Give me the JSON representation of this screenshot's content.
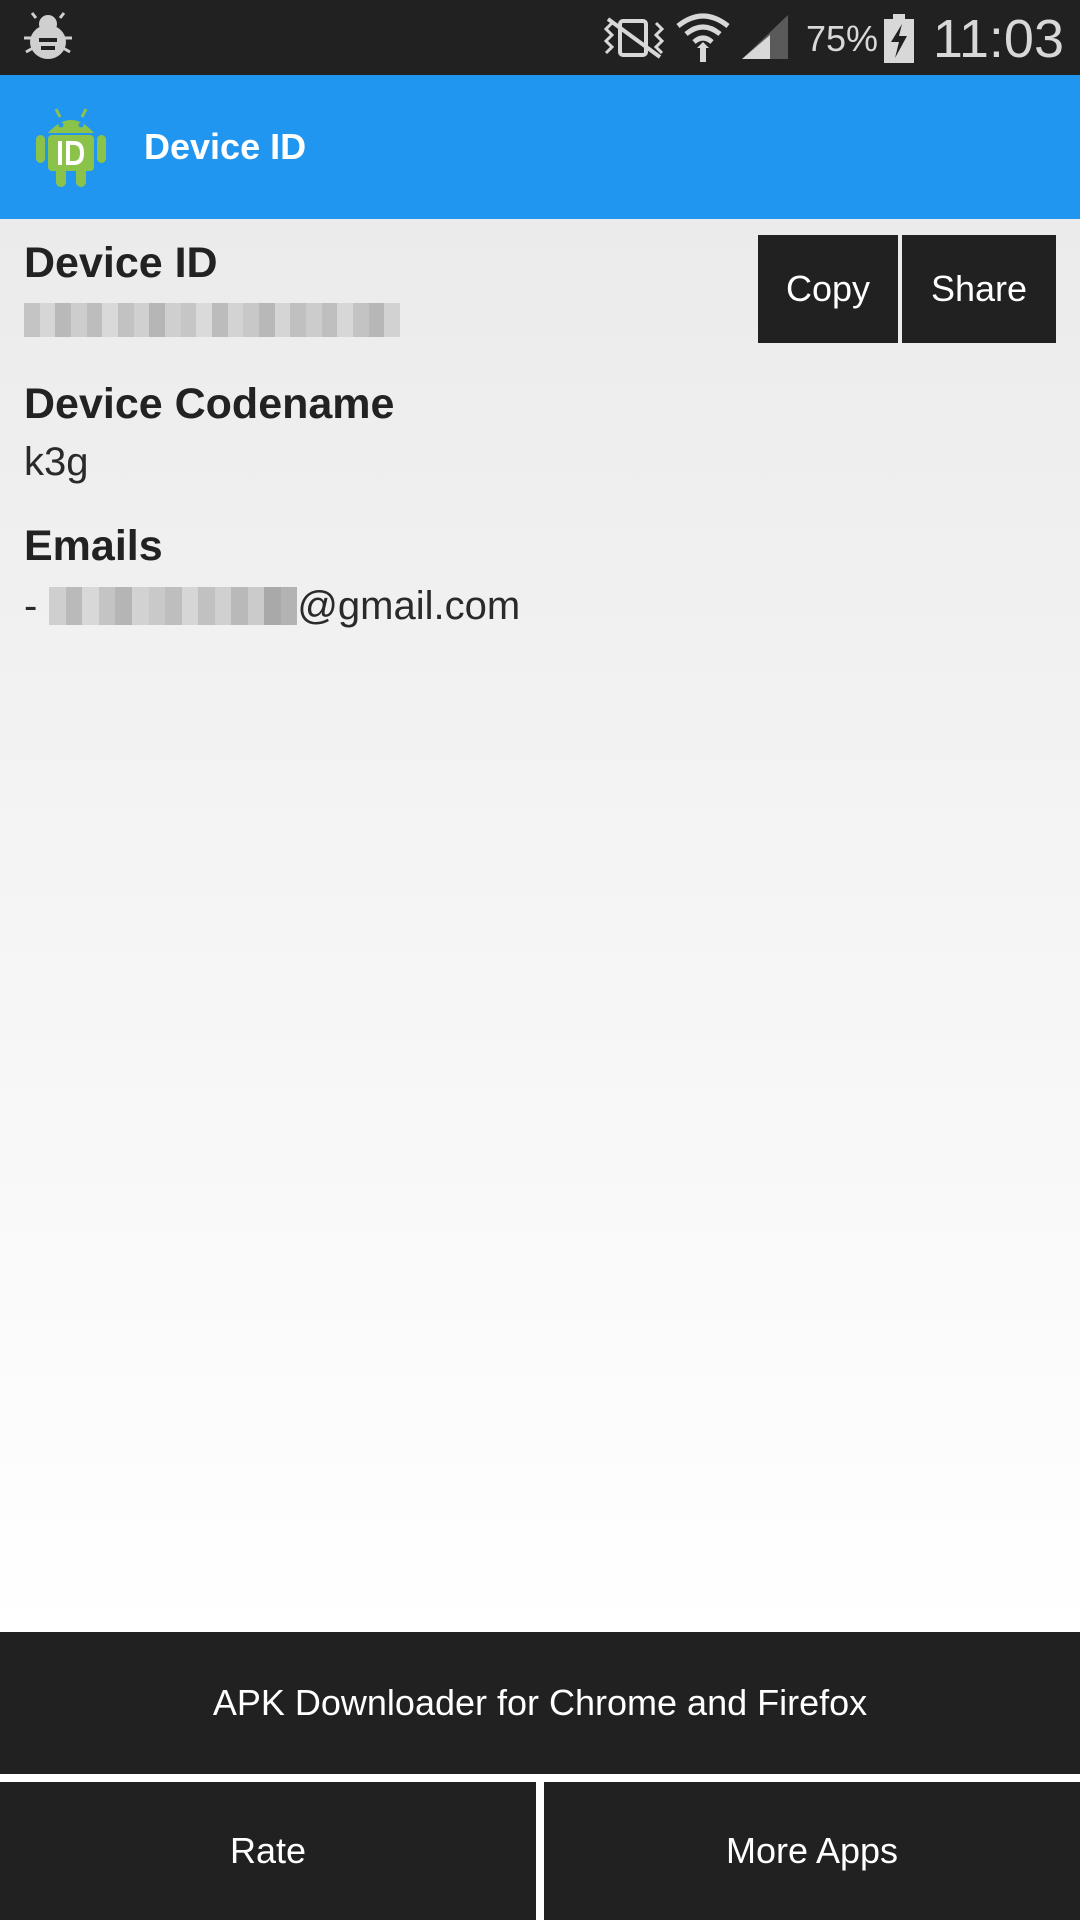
{
  "status_bar": {
    "battery_percent": "75%",
    "time": "11:03",
    "icons": [
      "debug-icon",
      "vibrate-icon",
      "wifi-icon",
      "signal-icon",
      "battery-charging-icon"
    ]
  },
  "action_bar": {
    "title": "Device ID",
    "icon": "android-id-icon",
    "color": "#2196f0"
  },
  "device_id": {
    "label": "Device ID",
    "value_redacted": true,
    "copy_label": "Copy",
    "share_label": "Share"
  },
  "device_codename": {
    "label": "Device Codename",
    "value": "k3g"
  },
  "emails": {
    "label": "Emails",
    "prefix": "-",
    "domain": "@gmail.com",
    "local_part_redacted": true
  },
  "footer": {
    "apk_label": "APK Downloader for Chrome and Firefox",
    "rate_label": "Rate",
    "more_apps_label": "More Apps",
    "button_color": "#212121"
  }
}
